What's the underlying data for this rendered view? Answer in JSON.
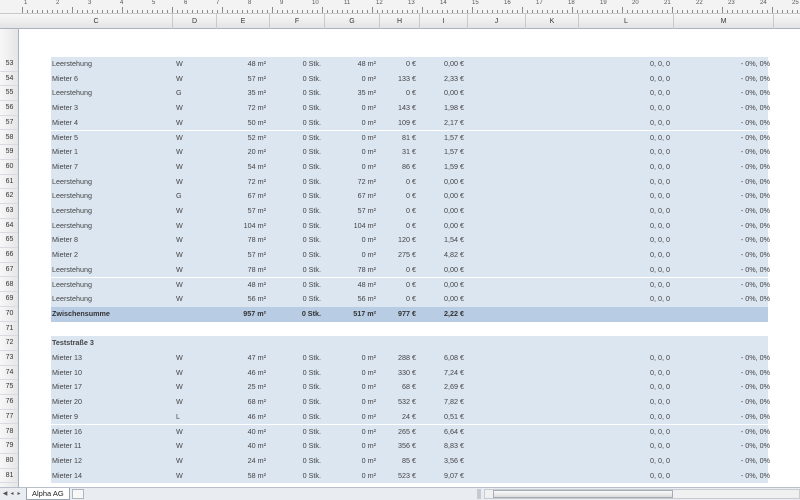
{
  "ruler": {
    "numbers": [
      "1",
      "2",
      "3",
      "4",
      "5",
      "6",
      "7",
      "8",
      "9",
      "10",
      "11",
      "12",
      "13",
      "14",
      "15",
      "16",
      "17",
      "18",
      "19",
      "20",
      "21",
      "22",
      "23",
      "24",
      "25"
    ]
  },
  "columns": [
    "C",
    "D",
    "E",
    "F",
    "G",
    "H",
    "I",
    "J",
    "K",
    "L",
    "M"
  ],
  "rows": [
    {
      "num": "53",
      "type": "data",
      "c": "Leerstehung",
      "d": "W",
      "e": "48 m²",
      "f": "0 Stk.",
      "g": "48 m²",
      "h": "0 €",
      "i": "0,00 €",
      "l": "0, 0, 0",
      "m": "- 0%, 0%"
    },
    {
      "num": "54",
      "type": "data",
      "c": "Mieter 6",
      "d": "W",
      "e": "57 m²",
      "f": "0 Stk.",
      "g": "0 m²",
      "h": "133 €",
      "i": "2,33 €",
      "l": "0, 0, 0",
      "m": "- 0%, 0%"
    },
    {
      "num": "55",
      "type": "data",
      "c": "Leerstehung",
      "d": "G",
      "e": "35 m²",
      "f": "0 Stk.",
      "g": "35 m²",
      "h": "0 €",
      "i": "0,00 €",
      "l": "0, 0, 0",
      "m": "- 0%, 0%"
    },
    {
      "num": "56",
      "type": "data",
      "c": "Mieter 3",
      "d": "W",
      "e": "72 m²",
      "f": "0 Stk.",
      "g": "0 m²",
      "h": "143 €",
      "i": "1,98 €",
      "l": "0, 0, 0",
      "m": "- 0%, 0%"
    },
    {
      "num": "57",
      "type": "data",
      "c": "Mieter 4",
      "d": "W",
      "e": "50 m²",
      "f": "0 Stk.",
      "g": "0 m²",
      "h": "109 €",
      "i": "2,17 €",
      "l": "0, 0, 0",
      "m": "- 0%, 0%"
    },
    {
      "num": "58",
      "type": "data",
      "c": "Mieter 5",
      "d": "W",
      "e": "52 m²",
      "f": "0 Stk.",
      "g": "0 m²",
      "h": "81 €",
      "i": "1,57 €",
      "l": "0, 0, 0",
      "m": "- 0%, 0%"
    },
    {
      "num": "59",
      "type": "data",
      "c": "Mieter 1",
      "d": "W",
      "e": "20 m²",
      "f": "0 Stk.",
      "g": "0 m²",
      "h": "31 €",
      "i": "1,57 €",
      "l": "0, 0, 0",
      "m": "- 0%, 0%"
    },
    {
      "num": "60",
      "type": "data",
      "c": "Mieter 7",
      "d": "W",
      "e": "54 m²",
      "f": "0 Stk.",
      "g": "0 m²",
      "h": "86 €",
      "i": "1,59 €",
      "l": "0, 0, 0",
      "m": "- 0%, 0%"
    },
    {
      "num": "61",
      "type": "data",
      "c": "Leerstehung",
      "d": "W",
      "e": "72 m²",
      "f": "0 Stk.",
      "g": "72 m²",
      "h": "0 €",
      "i": "0,00 €",
      "l": "0, 0, 0",
      "m": "- 0%, 0%"
    },
    {
      "num": "62",
      "type": "data",
      "c": "Leerstehung",
      "d": "G",
      "e": "67 m²",
      "f": "0 Stk.",
      "g": "67 m²",
      "h": "0 €",
      "i": "0,00 €",
      "l": "0, 0, 0",
      "m": "- 0%, 0%"
    },
    {
      "num": "63",
      "type": "data",
      "c": "Leerstehung",
      "d": "W",
      "e": "57 m²",
      "f": "0 Stk.",
      "g": "57 m²",
      "h": "0 €",
      "i": "0,00 €",
      "l": "0, 0, 0",
      "m": "- 0%, 0%"
    },
    {
      "num": "64",
      "type": "data",
      "c": "Leerstehung",
      "d": "W",
      "e": "104 m²",
      "f": "0 Stk.",
      "g": "104 m²",
      "h": "0 €",
      "i": "0,00 €",
      "l": "0, 0, 0",
      "m": "- 0%, 0%"
    },
    {
      "num": "65",
      "type": "data",
      "c": "Mieter 8",
      "d": "W",
      "e": "78 m²",
      "f": "0 Stk.",
      "g": "0 m²",
      "h": "120 €",
      "i": "1,54 €",
      "l": "0, 0, 0",
      "m": "- 0%, 0%"
    },
    {
      "num": "66",
      "type": "data",
      "c": "Mieter 2",
      "d": "W",
      "e": "57 m²",
      "f": "0 Stk.",
      "g": "0 m²",
      "h": "275 €",
      "i": "4,82 €",
      "l": "0, 0, 0",
      "m": "- 0%, 0%"
    },
    {
      "num": "67",
      "type": "data",
      "c": "Leerstehung",
      "d": "W",
      "e": "78 m²",
      "f": "0 Stk.",
      "g": "78 m²",
      "h": "0 €",
      "i": "0,00 €",
      "l": "0, 0, 0",
      "m": "- 0%, 0%"
    },
    {
      "num": "68",
      "type": "data",
      "c": "Leerstehung",
      "d": "W",
      "e": "48 m²",
      "f": "0 Stk.",
      "g": "48 m²",
      "h": "0 €",
      "i": "0,00 €",
      "l": "0, 0, 0",
      "m": "- 0%, 0%"
    },
    {
      "num": "69",
      "type": "data",
      "c": "Leerstehung",
      "d": "W",
      "e": "56 m²",
      "f": "0 Stk.",
      "g": "56 m²",
      "h": "0 €",
      "i": "0,00 €",
      "l": "0, 0, 0",
      "m": "- 0%, 0%"
    },
    {
      "num": "70",
      "type": "sum",
      "c": "Zwischensumme",
      "d": "",
      "e": "957 m²",
      "f": "0 Stk.",
      "g": "517 m²",
      "h": "977 €",
      "i": "2,22 €",
      "l": "",
      "m": ""
    },
    {
      "num": "71",
      "type": "blank"
    },
    {
      "num": "72",
      "type": "header",
      "c": "Teststraße 3"
    },
    {
      "num": "73",
      "type": "data",
      "c": "Mieter 13",
      "d": "W",
      "e": "47 m²",
      "f": "0 Stk.",
      "g": "0 m²",
      "h": "288 €",
      "i": "6,08 €",
      "l": "0, 0, 0",
      "m": "- 0%, 0%"
    },
    {
      "num": "74",
      "type": "data",
      "c": "Mieter 10",
      "d": "W",
      "e": "46 m²",
      "f": "0 Stk.",
      "g": "0 m²",
      "h": "330 €",
      "i": "7,24 €",
      "l": "0, 0, 0",
      "m": "- 0%, 0%"
    },
    {
      "num": "75",
      "type": "data",
      "c": "Mieter 17",
      "d": "W",
      "e": "25 m²",
      "f": "0 Stk.",
      "g": "0 m²",
      "h": "68 €",
      "i": "2,69 €",
      "l": "0, 0, 0",
      "m": "- 0%, 0%"
    },
    {
      "num": "76",
      "type": "data",
      "c": "Mieter 20",
      "d": "W",
      "e": "68 m²",
      "f": "0 Stk.",
      "g": "0 m²",
      "h": "532 €",
      "i": "7,82 €",
      "l": "0, 0, 0",
      "m": "- 0%, 0%"
    },
    {
      "num": "77",
      "type": "data",
      "c": "Mieter 9",
      "d": "L",
      "e": "46 m²",
      "f": "0 Stk.",
      "g": "0 m²",
      "h": "24 €",
      "i": "0,51 €",
      "l": "0, 0, 0",
      "m": "- 0%, 0%"
    },
    {
      "num": "78",
      "type": "data",
      "c": "Mieter 16",
      "d": "W",
      "e": "40 m²",
      "f": "0 Stk.",
      "g": "0 m²",
      "h": "265 €",
      "i": "6,64 €",
      "l": "0, 0, 0",
      "m": "- 0%, 0%"
    },
    {
      "num": "79",
      "type": "data",
      "c": "Mieter 11",
      "d": "W",
      "e": "40 m²",
      "f": "0 Stk.",
      "g": "0 m²",
      "h": "356 €",
      "i": "8,83 €",
      "l": "0, 0, 0",
      "m": "- 0%, 0%"
    },
    {
      "num": "80",
      "type": "data",
      "c": "Mieter 12",
      "d": "W",
      "e": "24 m²",
      "f": "0 Stk.",
      "g": "0 m²",
      "h": "85 €",
      "i": "3,56 €",
      "l": "0, 0, 0",
      "m": "- 0%, 0%"
    },
    {
      "num": "81",
      "type": "data",
      "c": "Mieter 14",
      "d": "W",
      "e": "58 m²",
      "f": "0 Stk.",
      "g": "0 m²",
      "h": "523 €",
      "i": "9,07 €",
      "l": "0, 0, 0",
      "m": "- 0%, 0%"
    }
  ],
  "sheet_tab": {
    "label": "Alpha AG"
  },
  "icons": {
    "new_sheet": "insert-sheet-icon"
  },
  "colors": {
    "band": "#dce6f1",
    "sum_band": "#b8cce4"
  }
}
